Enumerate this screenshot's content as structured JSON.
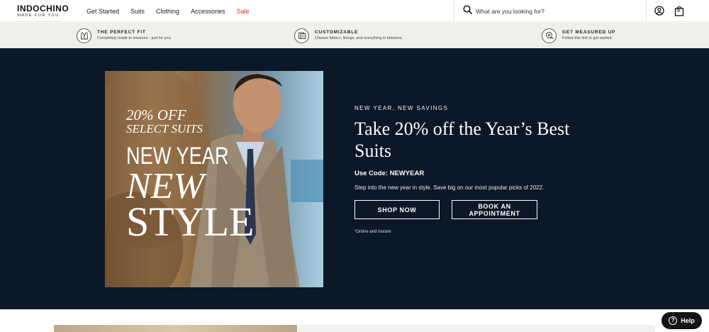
{
  "header": {
    "logo": "INDOCHINO",
    "tagline": "MADE FOR YOU",
    "nav": [
      {
        "label": "Get Started"
      },
      {
        "label": "Suits"
      },
      {
        "label": "Clothing"
      },
      {
        "label": "Accessories"
      },
      {
        "label": "Sale"
      }
    ],
    "search_placeholder": "What are you looking for?",
    "cart_count": "0",
    "icons": [
      "search-icon",
      "account-icon",
      "shopping-bag-icon"
    ]
  },
  "usp": [
    {
      "title": "THE PERFECT FIT",
      "text": "Completely made to measure - just for you.",
      "icon": "suit-icon"
    },
    {
      "title": "CUSTOMIZABLE",
      "text": "Choose fabrics, linings, and everything in between.",
      "icon": "fabric-swatch-icon"
    },
    {
      "title": "GET MEASURED UP",
      "text": "Follow this link to get started.",
      "icon": "measuring-tape-icon"
    }
  ],
  "hero": {
    "image_text": {
      "line1": "20% OFF",
      "line2": "SELECT SUITS",
      "line3": "NEW YEAR",
      "line4": "NEW",
      "line5": "STYLE"
    },
    "eyebrow": "NEW YEAR, NEW SAVINGS",
    "headline": "Take 20% off the Year’s Best Suits",
    "code": "Use Code: NEWYEAR",
    "description": "Step into the new year in style. Save big on our most popular picks of 2022.",
    "shop_label": "SHOP NOW",
    "book_label": "BOOK AN APPOINTMENT",
    "fineprint": "*Online and Instore"
  },
  "help_label": "Help",
  "colors": {
    "hero_bg": "#0b1827",
    "usp_bg": "#efefeb",
    "sale": "#d0312d"
  }
}
